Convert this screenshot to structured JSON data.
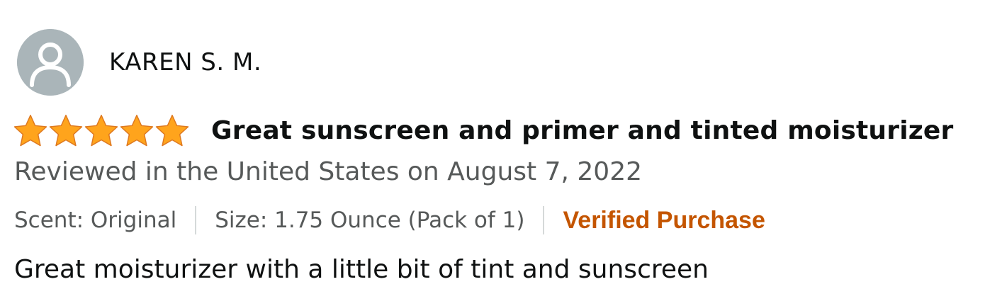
{
  "reviewer": {
    "name": "KAREN S. M.",
    "avatar_icon": "default-user-avatar-icon"
  },
  "rating": {
    "stars": 5,
    "max_stars": 5,
    "star_icon": "star-icon",
    "star_color": "#FFA41C"
  },
  "review": {
    "title": "Great sunscreen and primer and tinted moisturizer",
    "date_line": "Reviewed in the United States on August 7, 2022",
    "scent": "Scent: Original",
    "size": "Size: 1.75 Ounce (Pack of 1)",
    "verified": "Verified Purchase",
    "body": "Great moisturizer with a little bit of tint and sunscreen"
  },
  "colors": {
    "text_primary": "#0F1111",
    "text_secondary": "#565959",
    "verified": "#C45500",
    "avatar_bg": "#AAB5B9"
  }
}
